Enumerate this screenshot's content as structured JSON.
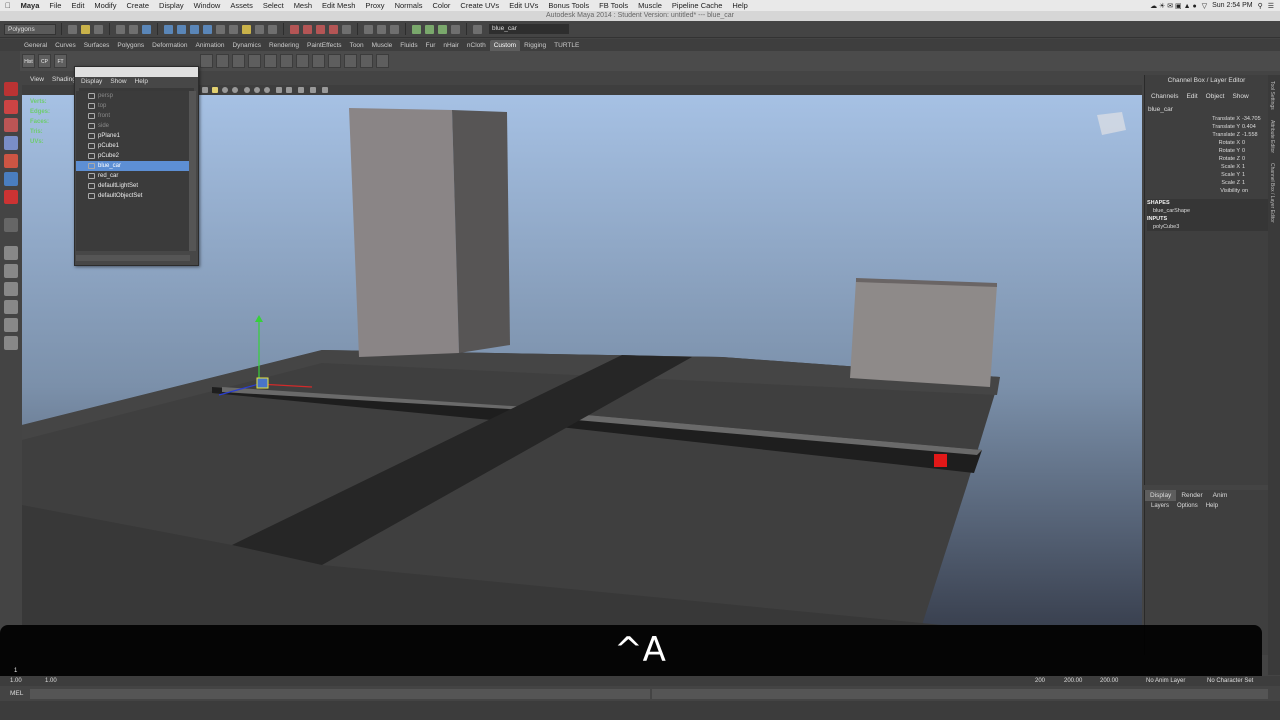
{
  "macmenu": {
    "items": [
      "Maya",
      "File",
      "Edit",
      "Modify",
      "Create",
      "Display",
      "Window",
      "Assets",
      "Select",
      "Mesh",
      "Edit Mesh",
      "Proxy",
      "Normals",
      "Color",
      "Create UVs",
      "Edit UVs",
      "Bonus Tools",
      "FB Tools",
      "Muscle",
      "Pipeline Cache",
      "Help"
    ],
    "clock": "Sun 2:54 PM"
  },
  "window_title": "Autodesk Maya 2014 : Student Version: untitled*   ---   blue_car",
  "statusline": {
    "mode": "Polygons",
    "name_field": "blue_car"
  },
  "shelf_tabs": [
    {
      "label": "General",
      "active": false
    },
    {
      "label": "Curves",
      "active": false
    },
    {
      "label": "Surfaces",
      "active": false
    },
    {
      "label": "Polygons",
      "active": false
    },
    {
      "label": "Deformation",
      "active": false
    },
    {
      "label": "Animation",
      "active": false
    },
    {
      "label": "Dynamics",
      "active": false
    },
    {
      "label": "Rendering",
      "active": false
    },
    {
      "label": "PaintEffects",
      "active": false
    },
    {
      "label": "Toon",
      "active": false
    },
    {
      "label": "Muscle",
      "active": false
    },
    {
      "label": "Fluids",
      "active": false
    },
    {
      "label": "Fur",
      "active": false
    },
    {
      "label": "nHair",
      "active": false
    },
    {
      "label": "nCloth",
      "active": false
    },
    {
      "label": "Custom",
      "active": true
    },
    {
      "label": "Rigging",
      "active": false
    },
    {
      "label": "TURTLE",
      "active": false
    }
  ],
  "shelf_icons": [
    "Hist",
    "CP",
    "FT",
    "",
    "",
    "",
    "",
    "",
    "",
    "",
    "",
    "",
    "",
    "",
    "",
    "",
    "",
    "",
    "",
    "",
    "",
    ""
  ],
  "panel_menus": [
    "View",
    "Shading"
  ],
  "hud": {
    "verts": "Verts:",
    "edges": "Edges:",
    "faces": "Faces:",
    "tris": "Tris:",
    "uvs": "UVs:"
  },
  "outliner": {
    "menus": [
      "Display",
      "Show",
      "Help"
    ],
    "rows": [
      {
        "label": "persp",
        "dim": true,
        "selected": false
      },
      {
        "label": "top",
        "dim": true,
        "selected": false
      },
      {
        "label": "front",
        "dim": true,
        "selected": false
      },
      {
        "label": "side",
        "dim": true,
        "selected": false
      },
      {
        "label": "pPlane1",
        "dim": false,
        "selected": false
      },
      {
        "label": "pCube1",
        "dim": false,
        "selected": false
      },
      {
        "label": "pCube2",
        "dim": false,
        "selected": false
      },
      {
        "label": "blue_car",
        "dim": false,
        "selected": true
      },
      {
        "label": "red_car",
        "dim": false,
        "selected": false
      },
      {
        "label": "defaultLightSet",
        "dim": false,
        "selected": false
      },
      {
        "label": "defaultObjectSet",
        "dim": false,
        "selected": false
      }
    ]
  },
  "channel_box": {
    "title": "Channel Box / Layer Editor",
    "menus": [
      "Channels",
      "Edit",
      "Object",
      "Show"
    ],
    "object": "blue_car",
    "channels": [
      {
        "name": "Translate X",
        "value": "-34.705"
      },
      {
        "name": "Translate Y",
        "value": "0.404"
      },
      {
        "name": "Translate Z",
        "value": "-1.558"
      },
      {
        "name": "Rotate X",
        "value": "0"
      },
      {
        "name": "Rotate Y",
        "value": "0"
      },
      {
        "name": "Rotate Z",
        "value": "0"
      },
      {
        "name": "Scale X",
        "value": "1"
      },
      {
        "name": "Scale Y",
        "value": "1"
      },
      {
        "name": "Scale Z",
        "value": "1"
      },
      {
        "name": "Visibility",
        "value": "on"
      }
    ],
    "shapes_header": "SHAPES",
    "shape": "blue_carShape",
    "inputs_header": "INPUTS",
    "input": "polyCube3"
  },
  "side_tabs": [
    "Tool Settings",
    "Attribute Editor",
    "Channel Box / Layer Editor"
  ],
  "layer_editor": {
    "tabs": [
      {
        "label": "Display",
        "active": true
      },
      {
        "label": "Render",
        "active": false
      },
      {
        "label": "Anim",
        "active": false
      }
    ],
    "menus": [
      "Layers",
      "Options",
      "Help"
    ]
  },
  "caption": "^A",
  "timeline": {
    "start": "1.00",
    "start2": "1.00",
    "current": "1",
    "end": "200",
    "end2": "200.00",
    "end3": "200.00",
    "anim_layer": "No Anim Layer",
    "character_set": "No Character Set",
    "mel_label": "MEL"
  }
}
